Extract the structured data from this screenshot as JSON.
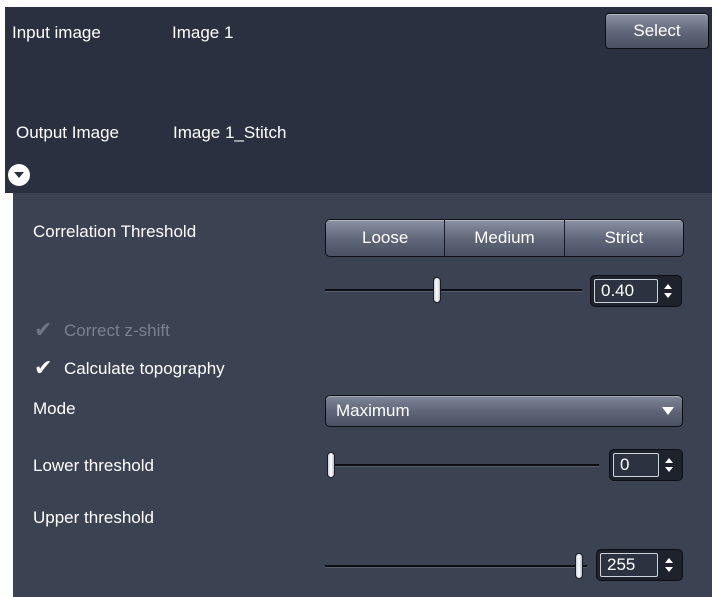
{
  "input": {
    "label": "Input image",
    "value": "Image 1",
    "select_label": "Select"
  },
  "output": {
    "label": "Output Image",
    "value": "Image 1_Stitch"
  },
  "correlation": {
    "label": "Correlation Threshold",
    "segments": [
      "Loose",
      "Medium",
      "Strict"
    ],
    "value": "0.40",
    "slider_fraction": 0.4
  },
  "correct_z_shift": {
    "label": "Correct z-shift",
    "checked": true,
    "enabled": false
  },
  "calculate_topography": {
    "label": "Calculate topography",
    "checked": true,
    "enabled": true
  },
  "mode": {
    "label": "Mode",
    "selected": "Maximum"
  },
  "lower_threshold": {
    "label": "Lower threshold",
    "value": "0",
    "slider_fraction": 0.0
  },
  "upper_threshold": {
    "label": "Upper threshold",
    "value": "255",
    "slider_fraction": 1.0
  }
}
